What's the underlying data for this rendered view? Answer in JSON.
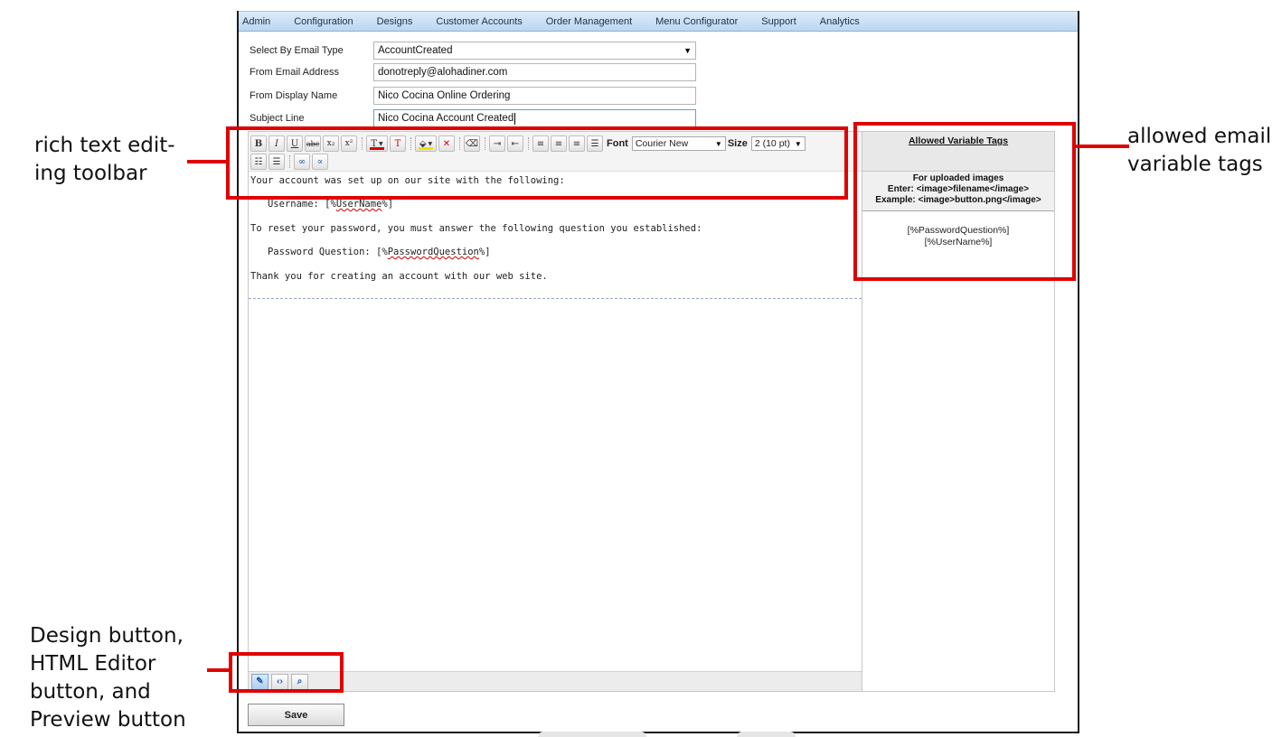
{
  "annotations": {
    "toolbar": [
      "rich text edit-",
      "ing toolbar"
    ],
    "tags": [
      "allowed email",
      "variable tags"
    ],
    "buttons": [
      "Design button,",
      "HTML Editor",
      "button, and",
      "Preview button"
    ]
  },
  "menu": [
    "Admin",
    "Configuration",
    "Designs",
    "Customer Accounts",
    "Order Management",
    "Menu Configurator",
    "Support",
    "Analytics"
  ],
  "form": {
    "email_type": {
      "label": "Select By Email Type",
      "value": "AccountCreated"
    },
    "from_email": {
      "label": "From Email Address",
      "value": "donotreply@alohadiner.com"
    },
    "display_name": {
      "label": "From Display Name",
      "value": "Nico Cocina Online Ordering"
    },
    "subject": {
      "label": "Subject Line",
      "value": "Nico Cocina Account Created"
    }
  },
  "toolbar": {
    "bold": "B",
    "italic": "I",
    "underline": "U",
    "strike": "abc",
    "subscript": "x₂",
    "superscript": "x²",
    "font_color": "T",
    "clear_color": "T",
    "font_label": "Font",
    "font_value": "Courier New",
    "size_label": "Size",
    "size_value": "2 (10 pt)"
  },
  "content": {
    "line1": "Your account was set up on our site with the following:",
    "line2_prefix": "   Username: [%",
    "line2_var": "UserName",
    "line2_suffix": "%]",
    "line3": "To reset your password, you must answer the following question you established:",
    "line4_prefix": "   Password Question: [%",
    "line4_var": "PasswordQuestion",
    "line4_suffix": "%]",
    "line5": "Thank you for creating an account with our web site."
  },
  "tags": {
    "title": "Allowed Variable Tags",
    "info_line1": "For uploaded images",
    "info_line2": "Enter: <image>filename</image>",
    "info_line3": "Example: <image>button.png</image>",
    "items": [
      "[%PasswordQuestion%]",
      "[%UserName%]"
    ]
  },
  "save_label": "Save",
  "colors": {
    "annotation_red": "#e00000",
    "menu_bar": "#cfe3f6"
  },
  "icons": [
    "pencil-icon",
    "html-code-icon",
    "magnifier-icon"
  ]
}
